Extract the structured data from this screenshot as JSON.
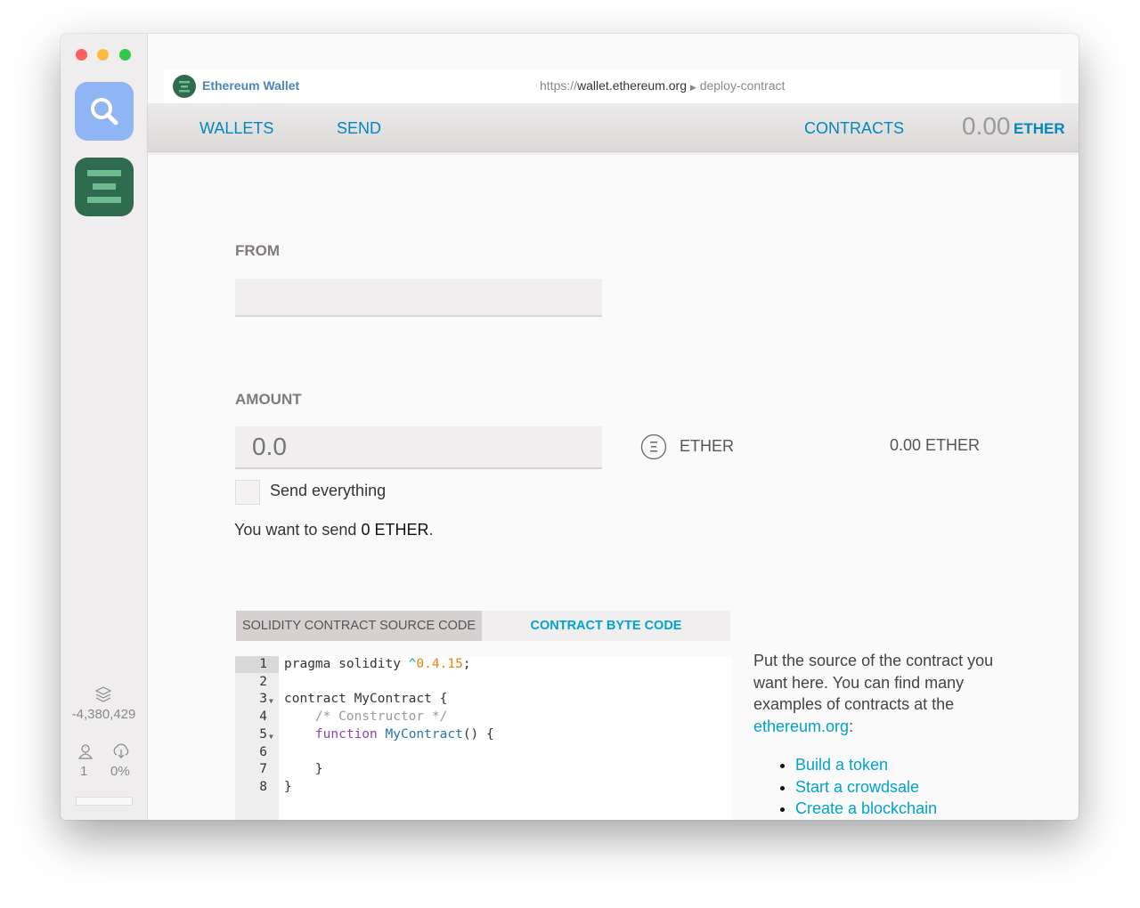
{
  "browser": {
    "app_name": "Ethereum Wallet",
    "url_scheme": "https://",
    "url_host": "wallet.ethereum.org",
    "url_path": "deploy-contract"
  },
  "nav": {
    "wallets": "WALLETS",
    "send": "SEND",
    "contracts": "CONTRACTS",
    "balance": "0.00",
    "balance_unit": "ETHER"
  },
  "form": {
    "from_label": "FROM",
    "amount_label": "AMOUNT",
    "amount_placeholder": "0.0",
    "currency": "ETHER",
    "total": "0.00 ETHER",
    "send_everything": "Send everything",
    "summary_prefix": "You want to send ",
    "summary_amount": "0 ETHER",
    "summary_suffix": "."
  },
  "tabs": {
    "source": "SOLIDITY CONTRACT SOURCE CODE",
    "bytecode": "CONTRACT BYTE CODE"
  },
  "editor": {
    "lines": [
      "1",
      "2",
      "3",
      "4",
      "5",
      "6",
      "7",
      "8"
    ],
    "l1a": "pragma solidity ",
    "l1b": "^",
    "l1c": "0.4.15",
    ";": ";",
    "l3": "contract MyContract {",
    "l4": "    /* Constructor */",
    "l5a": "    function ",
    "l5b": "MyContract",
    "l5c": "() {",
    "l7": "    }",
    "l8": "}"
  },
  "help": {
    "text": "Put the source of the contract you want here. You can find many examples of contracts at the",
    "link": "ethereum.org",
    "colon": ":",
    "items": [
      "Build a token",
      "Start a crowdsale",
      "Create a blockchain"
    ]
  },
  "status": {
    "block": "-4,380,429",
    "peers": "1",
    "sync": "0%"
  },
  "colors": {
    "accent": "#0287c1",
    "link": "#00a3d0"
  }
}
